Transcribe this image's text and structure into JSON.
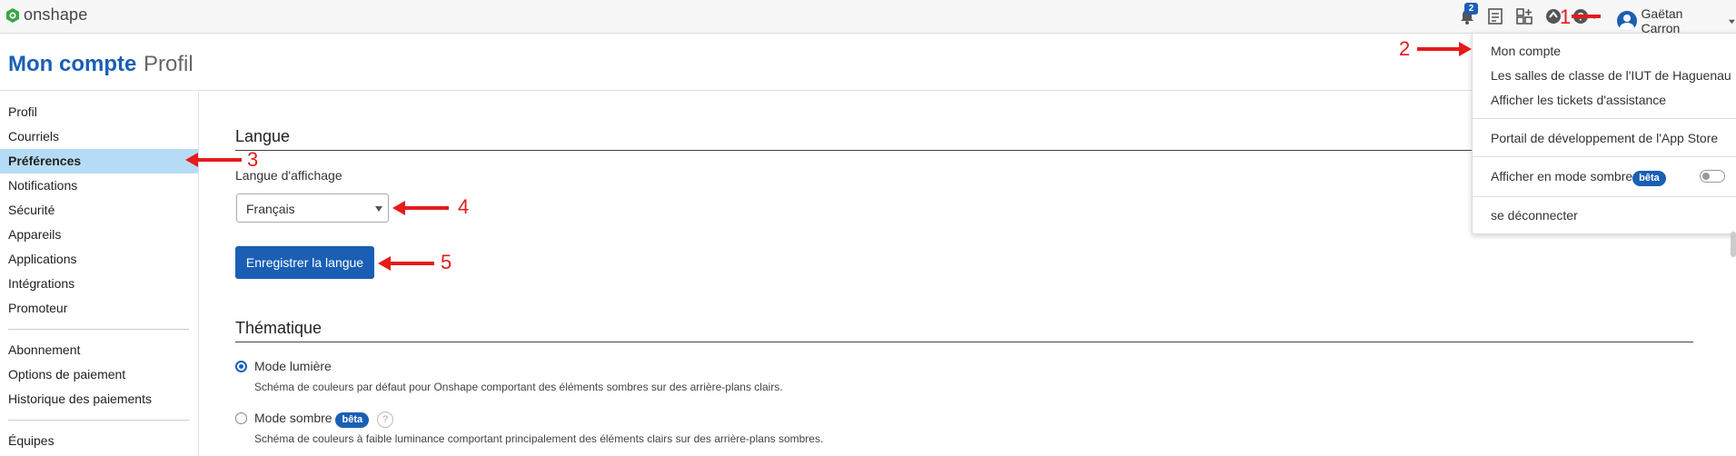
{
  "app": {
    "name": "onshape"
  },
  "topbar": {
    "notification_count": "2",
    "user_name": "Gaëtan Carron",
    "icons": [
      "notifications-icon",
      "tasks-icon",
      "app-store-icon",
      "learning-center-icon",
      "help-icon",
      "user-avatar"
    ]
  },
  "header": {
    "title": "Mon compte",
    "subtitle": "Profil"
  },
  "sidebar": {
    "items": [
      {
        "label": "Profil"
      },
      {
        "label": "Courriels"
      },
      {
        "label": "Préférences",
        "active": true
      },
      {
        "label": "Notifications"
      },
      {
        "label": "Sécurité"
      },
      {
        "label": "Appareils"
      },
      {
        "label": "Applications"
      },
      {
        "label": "Intégrations"
      },
      {
        "label": "Promoteur"
      },
      {
        "label": "Abonnement"
      },
      {
        "label": "Options de paiement"
      },
      {
        "label": "Historique des paiements"
      },
      {
        "label": "Équipes"
      }
    ]
  },
  "language": {
    "section_title": "Langue",
    "field_label": "Langue d'affichage",
    "selected": "Français",
    "save_button": "Enregistrer la langue"
  },
  "theme": {
    "section_title": "Thématique",
    "options": [
      {
        "label": "Mode lumière",
        "desc": "Schéma de couleurs par défaut pour Onshape comportant des éléments sombres sur des arrière-plans clairs.",
        "selected": true
      },
      {
        "label": "Mode sombre",
        "badge": "bêta",
        "desc": "Schéma de couleurs à faible luminance comportant principalement des éléments clairs sur des arrière-plans sombres.",
        "selected": false
      }
    ]
  },
  "dropdown": {
    "items": [
      {
        "label": "Mon compte"
      },
      {
        "label": "Les salles de classe de l'IUT de Haguenau"
      },
      {
        "label": "Afficher les tickets d'assistance"
      },
      {
        "label": "Portail de développement de l'App Store"
      },
      {
        "label": "Afficher en mode sombre",
        "badge": "bêta",
        "toggle": false
      },
      {
        "label": "se déconnecter"
      }
    ]
  },
  "annotations": [
    "1",
    "2",
    "3",
    "4",
    "5"
  ],
  "colors": {
    "accent": "#1a5fb4",
    "active_nav": "#b6dcf5",
    "annotation": "#e51b1b"
  }
}
